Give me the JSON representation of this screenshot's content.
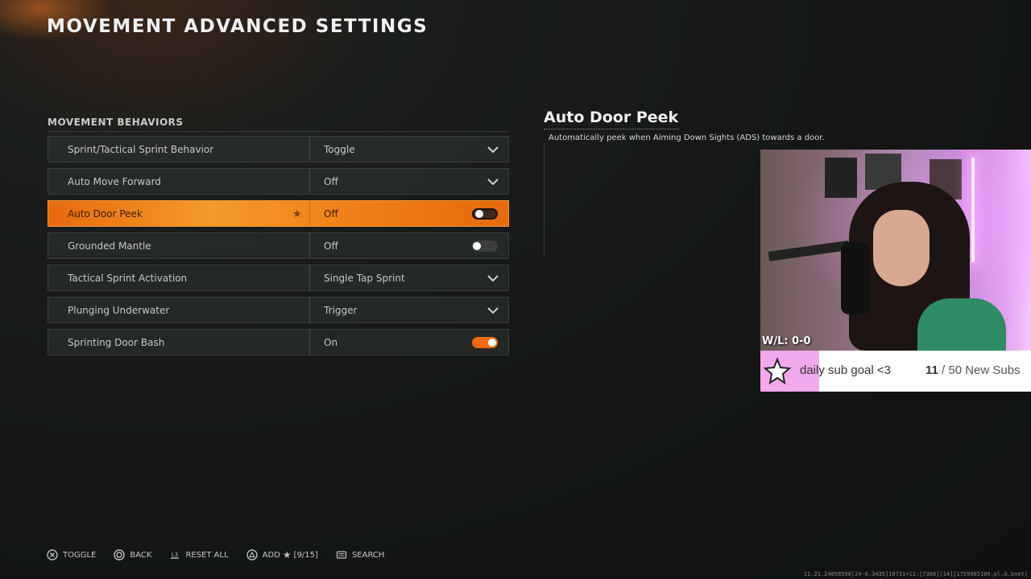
{
  "page": {
    "title": "MOVEMENT ADVANCED SETTINGS"
  },
  "section": {
    "title": "MOVEMENT BEHAVIORS"
  },
  "settings": [
    {
      "label": "Sprint/Tactical Sprint Behavior",
      "value": "Toggle",
      "control": "dropdown"
    },
    {
      "label": "Auto Move Forward",
      "value": "Off",
      "control": "dropdown"
    },
    {
      "label": "Auto Door Peek",
      "value": "Off",
      "control": "toggle-off",
      "selected": true,
      "favorite": true
    },
    {
      "label": "Grounded Mantle",
      "value": "Off",
      "control": "toggle-off"
    },
    {
      "label": "Tactical Sprint Activation",
      "value": "Single Tap Sprint",
      "control": "dropdown"
    },
    {
      "label": "Plunging Underwater",
      "value": "Trigger",
      "control": "dropdown"
    },
    {
      "label": "Sprinting Door Bash",
      "value": "On",
      "control": "toggle-on"
    }
  ],
  "description": {
    "title": "Auto Door Peek",
    "text": "Automatically peek when Aiming Down Sights (ADS) towards a door."
  },
  "overlay": {
    "wl": "W/L: 0-0",
    "goal_label": "daily sub goal <3",
    "goal_current": "11",
    "goal_rest": "/ 50 New Subs"
  },
  "footer": {
    "toggle": "TOGGLE",
    "back": "BACK",
    "reset": "RESET ALL",
    "add": "ADD",
    "add_count": "[9/15]",
    "search": "SEARCH",
    "reset_button_glyph": "L3"
  },
  "build_info": "11.21.24058598[24-0.3435]10731+11:[7300][14][1759965109.pl.G.bnet]",
  "colors": {
    "accent": "#f07d16",
    "background": "#141716"
  }
}
